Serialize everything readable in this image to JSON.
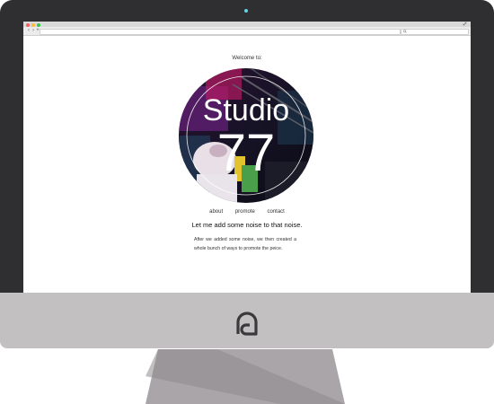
{
  "page": {
    "welcome": "Welcome to:",
    "logo": {
      "name": "Studio",
      "number": "77"
    },
    "nav": {
      "about": "about",
      "promote": "promote",
      "contact": "contact"
    },
    "headline": "Let me add some noise to that noise.",
    "body": "After we added some noise, we then created a whole bunch of ways to promote the peice."
  },
  "icons": {
    "camera": "camera-dot-icon",
    "brand": "brand-logo-icon",
    "back": "back-arrow-icon",
    "forward": "forward-arrow-icon",
    "new_tab": "plus-icon",
    "search": "search-icon",
    "fullscreen": "fullscreen-icon"
  },
  "colors": {
    "bezel": "#2f2f31",
    "chin": "#c3c0c2",
    "stand": "#a9a5a8",
    "camera": "#63d3df",
    "traffic_red": "#fc605c",
    "traffic_yellow": "#fdbc40",
    "traffic_green": "#34c84a"
  }
}
